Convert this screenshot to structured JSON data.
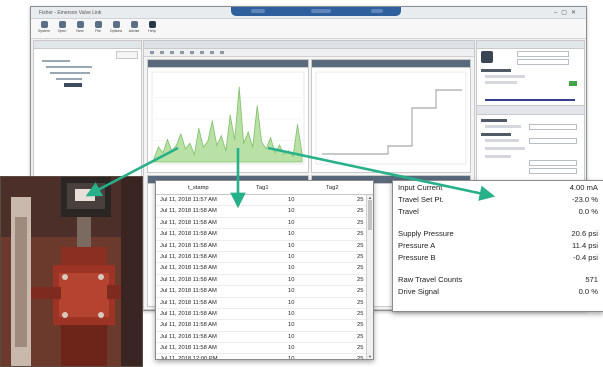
{
  "app": {
    "title": "Fisher - Emerson Valve Link",
    "ribbon": [
      {
        "label": "System",
        "icon": "system-icon"
      },
      {
        "label": "Open",
        "icon": "open-icon"
      },
      {
        "label": "New",
        "icon": "new-icon"
      },
      {
        "label": "File",
        "icon": "file-icon"
      },
      {
        "label": "Options",
        "icon": "options-icon"
      },
      {
        "label": "Advise",
        "icon": "advise-icon"
      },
      {
        "label": "Help",
        "icon": "help-icon"
      }
    ]
  },
  "table": {
    "columns": [
      "t_stamp",
      "Tag1",
      "Tag2"
    ],
    "rows": [
      [
        "Jul 11, 2018 11:57 AM",
        "10",
        "25"
      ],
      [
        "Jul 11, 2018 11:58 AM",
        "10",
        "25"
      ],
      [
        "Jul 11, 2018 11:58 AM",
        "10",
        "25"
      ],
      [
        "Jul 11, 2018 11:58 AM",
        "10",
        "25"
      ],
      [
        "Jul 11, 2018 11:58 AM",
        "10",
        "25"
      ],
      [
        "Jul 11, 2018 11:58 AM",
        "10",
        "25"
      ],
      [
        "Jul 11, 2018 11:58 AM",
        "10",
        "25"
      ],
      [
        "Jul 11, 2018 11:58 AM",
        "10",
        "25"
      ],
      [
        "Jul 11, 2018 11:58 AM",
        "10",
        "25"
      ],
      [
        "Jul 11, 2018 11:58 AM",
        "10",
        "25"
      ],
      [
        "Jul 11, 2018 11:58 AM",
        "10",
        "25"
      ],
      [
        "Jul 11, 2018 11:58 AM",
        "10",
        "25"
      ],
      [
        "Jul 11, 2018 11:58 AM",
        "10",
        "25"
      ],
      [
        "Jul 11, 2018 11:58 AM",
        "10",
        "25"
      ],
      [
        "Jul 11, 2018 12:00 PM",
        "10",
        "25"
      ],
      [
        "Jul 11, 2018 12:00 PM",
        "10",
        "25"
      ]
    ]
  },
  "values": [
    {
      "label": "Input Current",
      "value": "4.00 mA"
    },
    {
      "label": "Travel Set Pt.",
      "value": "-23.0 %"
    },
    {
      "label": "Travel",
      "value": "0.0 %"
    },
    {
      "label": "Supply Pressure",
      "value": "20.6 psi"
    },
    {
      "label": "Pressure A",
      "value": "11.4 psi"
    },
    {
      "label": "Pressure B",
      "value": "-0.4 psi"
    },
    {
      "label": "Raw Travel Counts",
      "value": "571"
    },
    {
      "label": "Drive Signal",
      "value": "0.0 %"
    }
  ],
  "colors": {
    "arrow": "#27b08a",
    "chart_fill": "#b9e0a5",
    "chart_line": "#7fc06a",
    "panel_header": "#596a7d"
  },
  "chart_data": {
    "type": "area",
    "series": [
      {
        "values": [
          2,
          8,
          5,
          12,
          6,
          9,
          15,
          7,
          10,
          4,
          18,
          8,
          11,
          22,
          9,
          14,
          6,
          25,
          12,
          40,
          10,
          16,
          8,
          30,
          11,
          7,
          13,
          5,
          9,
          4,
          6,
          3,
          20,
          5
        ]
      }
    ]
  }
}
